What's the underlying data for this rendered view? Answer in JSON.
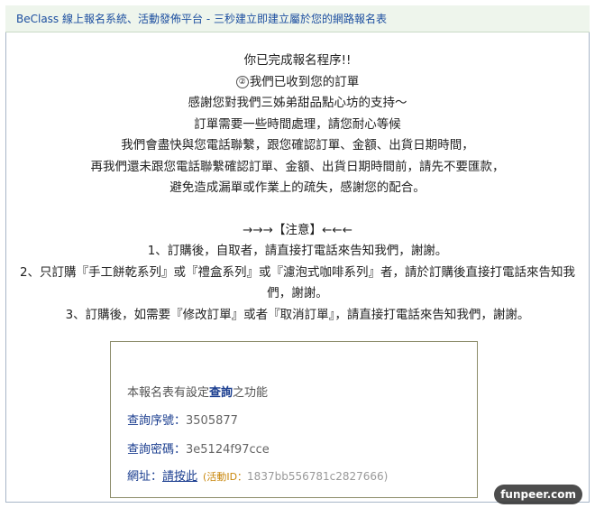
{
  "header": {
    "title": "BeClass 線上報名系統、活動發佈平台 - 三秒建立即建立屬於您的網路報名表"
  },
  "message": {
    "lines": [
      "你已完成報名程序!!",
      "我們已收到您的訂單",
      "感謝您對我們三姊弟甜品點心坊的支持～",
      "訂單需要一些時間處理，請您耐心等候",
      "我們會盡快與您電話聯繫，跟您確認訂單、金額、出貨日期時間，",
      "再我們還未跟您電話聯繫確認訂單、金額、出貨日期時間前，請先不要匯款，",
      "避免造成漏單或作業上的疏失，感謝您的配合。"
    ],
    "circle_mark": "②"
  },
  "notice": {
    "title": "→→→【注意】←←←",
    "items": [
      "1、訂購後，自取者，請直接打電話來告知我們，謝謝。",
      "2、只訂購『手工餅乾系列』或『禮盒系列』或『濾泡式咖啡系列』者，請於訂購後直接打電話來告知我們，謝謝。",
      "3、訂購後，如需要『修改訂單』或者『取消訂單』，請直接打電話來告知我們，謝謝。"
    ]
  },
  "query_box": {
    "intro_before": "本報名表有設定",
    "intro_link": "查詢",
    "intro_after": "之功能",
    "serial_label": "查詢序號：",
    "serial_value": "3505877",
    "password_label": "查詢密碼：",
    "password_value": "3e5124f97cce",
    "url_label": "網址：",
    "url_link": "請按此",
    "event_label": "(活動ID：",
    "event_id": "1837bb556781c2827666)"
  },
  "watermark": {
    "text": "funpeer.com"
  }
}
